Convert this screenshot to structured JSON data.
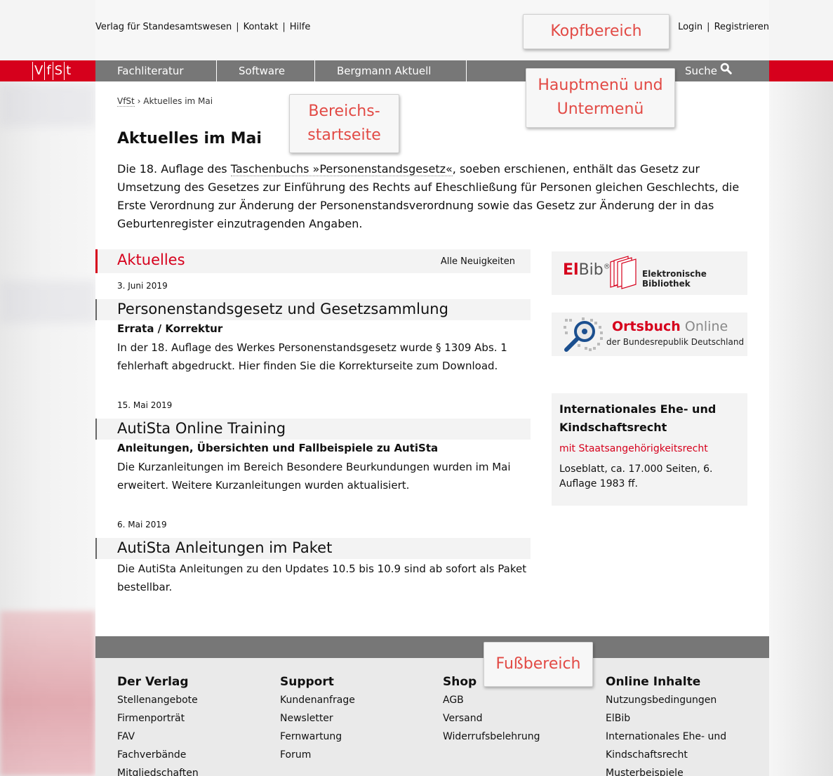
{
  "header": {
    "links": [
      "Verlag für Standesamtswesen",
      "Kontakt",
      "Hilfe"
    ],
    "account_links": [
      "Login",
      "Registrieren"
    ]
  },
  "logo": {
    "letters": [
      "V",
      "f",
      "S",
      "t"
    ]
  },
  "nav": {
    "items": [
      "Fachliteratur",
      "Software",
      "Bergmann Aktuell"
    ],
    "search_label": "Suche"
  },
  "breadcrumb": {
    "home": "VfSt",
    "separator": "›",
    "current": "Aktuelles im Mai"
  },
  "page": {
    "title": "Aktuelles im Mai",
    "intro_before": "Die 18. Auflage des ",
    "intro_link": "Taschenbuchs »Personenstandsgesetz«",
    "intro_after": ", soeben erschienen, enthält das Gesetz zur Umsetzung des Gesetzes zur Einführung des Rechts auf Eheschließung für Personen gleichen Geschlechts, die Erste Verordnung zur Änderung der Personenstandsverordnung sowie das Gesetz zur Änderung der in das Geburtenregister einzutragenden Angaben."
  },
  "news": {
    "heading": "Aktuelles",
    "all_link": "Alle Neuigkeiten",
    "items": [
      {
        "date": "3. Juni 2019",
        "title": "Personenstandsgesetz und Gesetzsammlung",
        "subtitle": "Errata / Korrektur",
        "text": "In der 18. Auflage des Werkes Personenstandsgesetz wurde § 1309 Abs. 1 fehlerhaft abgedruckt. Hier finden Sie die Korrekturseite zum Download."
      },
      {
        "date": "15. Mai 2019",
        "title": "AutiSta Online Training",
        "subtitle": "Anleitungen, Übersichten und Fallbeispiele zu AutiSta",
        "text": "Die Kurzanleitungen im Bereich Besondere Beurkundungen wurden im Mai erweitert. Weitere Kurzanleitungen wurden aktualisiert."
      },
      {
        "date": "6. Mai 2019",
        "title": "AutiSta Anleitungen im Paket",
        "subtitle": "",
        "text": "Die AutiSta Anleitungen zu den Updates 10.5 bis 10.9 sind ab sofort als Paket bestellbar."
      }
    ]
  },
  "sidebar": {
    "elbib": {
      "logo_a": "El",
      "logo_b": "Bib",
      "reg": "®",
      "caption": "Elektronische Bibliothek"
    },
    "ortsbuch": {
      "title_a": "Ortsbuch",
      "title_b": "Online",
      "caption": "der Bundesrepublik Deutschland"
    },
    "intl": {
      "title": "Internationales Ehe- und Kindschaftsrecht",
      "subtitle": "mit Staatsangehörigkeitsrecht",
      "desc": "Loseblatt, ca. 17.000 Seiten, 6. Auflage 1983 ff."
    }
  },
  "footer": {
    "columns": [
      {
        "heading": "Der Verlag",
        "links": [
          "Stellenangebote",
          "Firmenporträt",
          "FAV",
          "Fachverbände",
          "Mitgliedschaften"
        ]
      },
      {
        "heading": "Support",
        "links": [
          "Kundenanfrage",
          "Newsletter",
          "Fernwartung",
          "Forum"
        ]
      },
      {
        "heading": "Shop",
        "links": [
          "AGB",
          "Versand",
          "Widerrufsbelehrung"
        ]
      },
      {
        "heading": "Online Inhalte",
        "links": [
          "Nutzungsbedingungen",
          "ElBib",
          "Internationales Ehe- und",
          "Kindschaftsrecht",
          "Musterbeispiele"
        ]
      }
    ]
  },
  "annotations": {
    "kopf": "Kopfbereich",
    "haupt_line1": "Hauptmenü und",
    "haupt_line2": "Untermenü",
    "bereich_line1": "Bereichs-",
    "bereich_line2": "startseite",
    "fuss": "Fußbereich"
  },
  "colors": {
    "accent": "#d6001c",
    "nav_gray": "#777777",
    "annotation_text": "#e24a45"
  }
}
